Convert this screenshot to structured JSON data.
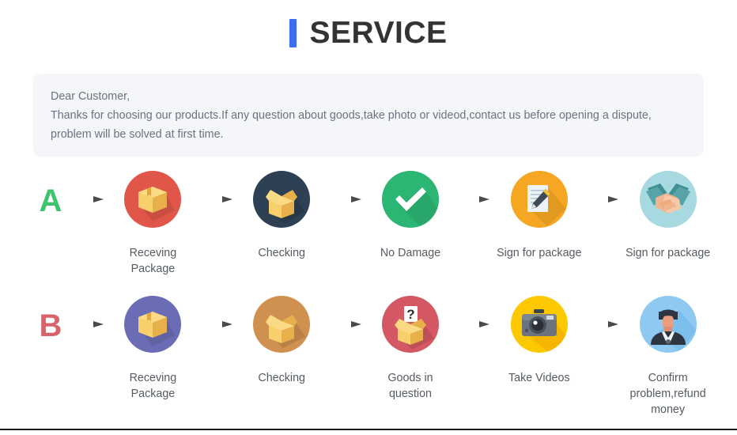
{
  "header": {
    "accent_color": "#3a6df0",
    "title": "SERVICE"
  },
  "notice": {
    "background_color": "#f5f6fa",
    "lines": [
      "Dear Customer,",
      "Thanks for choosing our products.If any question about goods,take photo or videod,contact us before opening a dispute, problem will be solved at first time."
    ]
  },
  "flows": [
    {
      "letter": "A",
      "letter_color": "#3ec46d",
      "steps": [
        {
          "label": "Receving Package",
          "icon": "closed-box-icon",
          "circle_color": "#e05649"
        },
        {
          "label": "Checking",
          "icon": "open-box-icon",
          "circle_color": "#2e4053"
        },
        {
          "label": "No Damage",
          "icon": "check-mark-icon",
          "circle_color": "#2bb673"
        },
        {
          "label": "Sign for package",
          "icon": "document-pen-icon",
          "circle_color": "#f5a623"
        },
        {
          "label": "Sign for package",
          "icon": "handshake-icon",
          "circle_color": "#9fd4dc"
        }
      ]
    },
    {
      "letter": "B",
      "letter_color": "#d9636b",
      "steps": [
        {
          "label": "Receving Package",
          "icon": "closed-box-icon",
          "circle_color": "#6a6cb5"
        },
        {
          "label": "Checking",
          "icon": "open-box-icon",
          "circle_color": "#cf9050"
        },
        {
          "label": "Goods in question",
          "icon": "question-box-icon",
          "circle_color": "#d45863"
        },
        {
          "label": "Take Videos",
          "icon": "camera-icon",
          "circle_color": "#fcc900"
        },
        {
          "label": "Confirm problem,refund money",
          "icon": "person-avatar-icon",
          "circle_color": "#8fc9f2"
        }
      ]
    }
  ],
  "arrow": {
    "name": "right-arrow-icon",
    "color": "#4a4a4a"
  }
}
